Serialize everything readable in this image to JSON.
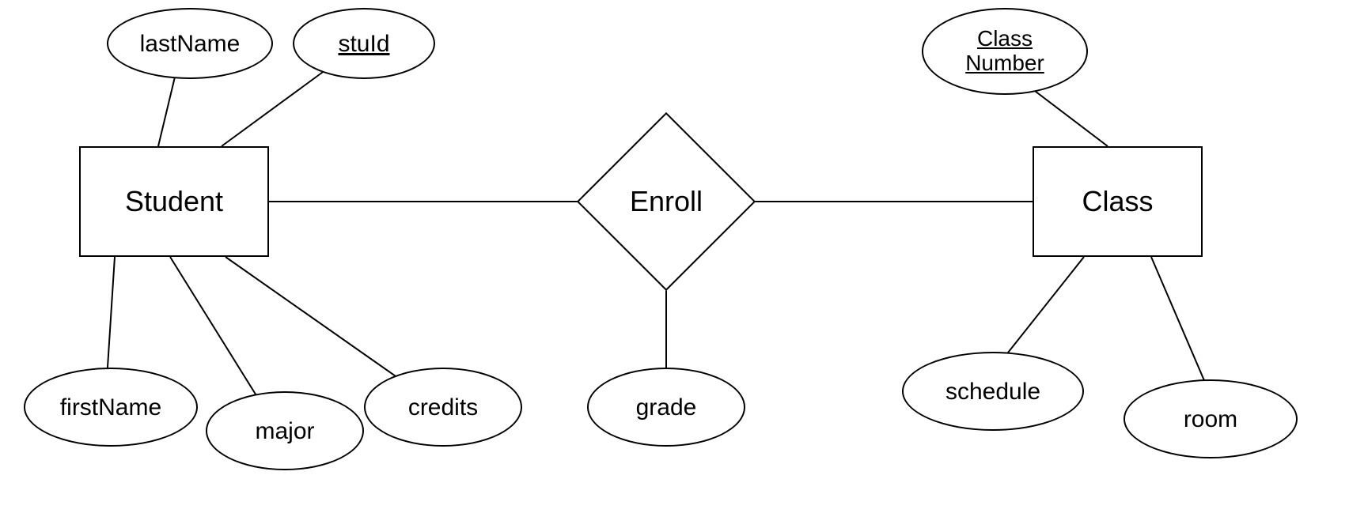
{
  "entities": {
    "student": {
      "label": "Student"
    },
    "class": {
      "label": "Class"
    }
  },
  "relationship": {
    "enroll": {
      "label": "Enroll"
    }
  },
  "attributes": {
    "lastName": {
      "label": "lastName"
    },
    "stuId": {
      "label": "stuId"
    },
    "firstName": {
      "label": "firstName"
    },
    "major": {
      "label": "major"
    },
    "credits": {
      "label": "credits"
    },
    "grade": {
      "label": "grade"
    },
    "classNumber": {
      "label": "Class\nNumber"
    },
    "schedule": {
      "label": "schedule"
    },
    "room": {
      "label": "room"
    }
  }
}
